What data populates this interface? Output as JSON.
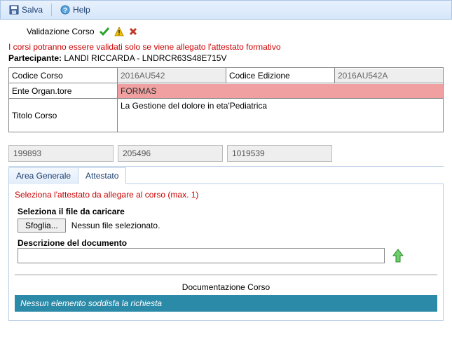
{
  "toolbar": {
    "save_label": "Salva",
    "help_label": "Help"
  },
  "validation": {
    "label": "Validazione Corso"
  },
  "warning_text": "I corsi potranno essere validati solo se viene allegato l'attestato formativo",
  "participant": {
    "label": "Partecipante:",
    "value": "LANDI RICCARDA - LNDRCR63S48E715V"
  },
  "form": {
    "codice_corso_label": "Codice Corso",
    "codice_corso_value": "2016AU542",
    "codice_edizione_label": "Codice Edizione",
    "codice_edizione_value": "2016AU542A",
    "ente_label": "Ente Organ.tore",
    "ente_value": "FORMAS",
    "titolo_label": "Titolo Corso",
    "titolo_value": "La Gestione del dolore in eta'Pediatrica"
  },
  "numbers": {
    "a": "199893",
    "b": "205496",
    "c": "1019539"
  },
  "tabs": {
    "generale": "Area Generale",
    "attestato": "Attestato"
  },
  "attach_note": "Seleziona l'attestato da allegare al corso (max. 1)",
  "upload": {
    "select_label": "Seleziona il file da caricare",
    "browse_label": "Sfoglia...",
    "no_file": "Nessun file selezionato.",
    "desc_label": "Descrizione del documento",
    "desc_value": ""
  },
  "doc_section": {
    "title": "Documentazione Corso",
    "empty_msg": "Nessun elemento soddisfa la richiesta"
  }
}
